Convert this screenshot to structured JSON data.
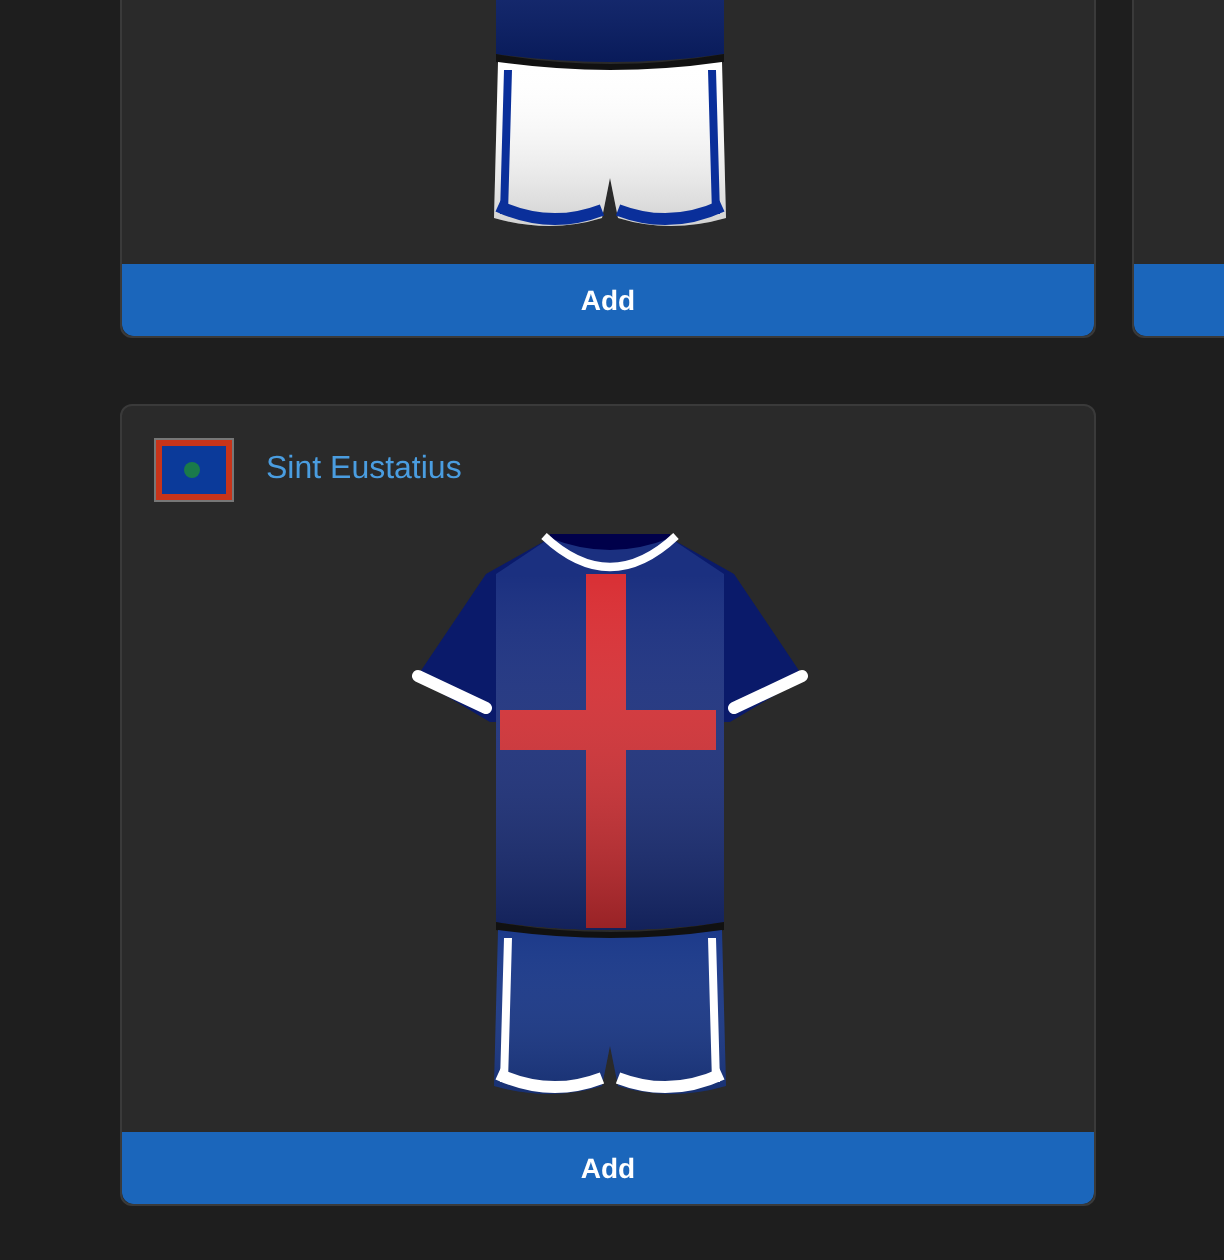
{
  "cards": [
    {
      "kind": "full",
      "kit": {
        "kind": "plain"
      },
      "button": {
        "label": "Add"
      }
    },
    {
      "kind": "edge"
    },
    {
      "kind": "full",
      "name": "Sint Eustatius",
      "kit": {
        "kind": "cross"
      },
      "button": {
        "label": "Add"
      }
    }
  ]
}
